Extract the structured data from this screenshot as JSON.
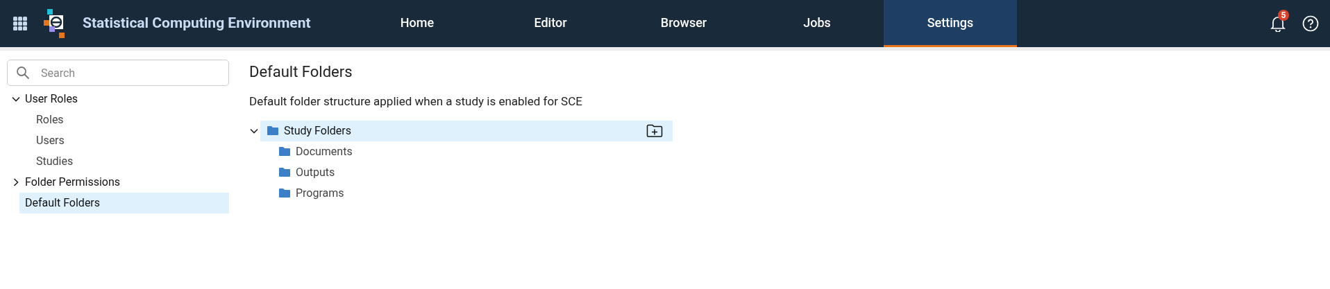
{
  "app": {
    "title": "Statistical Computing Environment"
  },
  "nav": [
    {
      "label": "Home",
      "selected": false
    },
    {
      "label": "Editor",
      "selected": false
    },
    {
      "label": "Browser",
      "selected": false
    },
    {
      "label": "Jobs",
      "selected": false
    },
    {
      "label": "Settings",
      "selected": true
    }
  ],
  "notifications": {
    "count": "5"
  },
  "sidebar": {
    "search": {
      "placeholder": "Search"
    },
    "items": [
      {
        "label": "User Roles",
        "expanded": true,
        "selected": false,
        "children": [
          {
            "label": "Roles",
            "selected": false
          },
          {
            "label": "Users",
            "selected": false
          },
          {
            "label": "Studies",
            "selected": false
          }
        ]
      },
      {
        "label": "Folder Permissions",
        "expanded": false,
        "selected": false
      },
      {
        "label": "Default Folders",
        "selected": true
      }
    ]
  },
  "main": {
    "title": "Default Folders",
    "description": "Default folder structure applied when a study is enabled for SCE",
    "tree": [
      {
        "label": "Study Folders",
        "expanded": true,
        "selected": true,
        "children": [
          {
            "label": "Documents",
            "selected": false
          },
          {
            "label": "Outputs",
            "selected": false
          },
          {
            "label": "Programs",
            "selected": false
          }
        ]
      }
    ]
  }
}
